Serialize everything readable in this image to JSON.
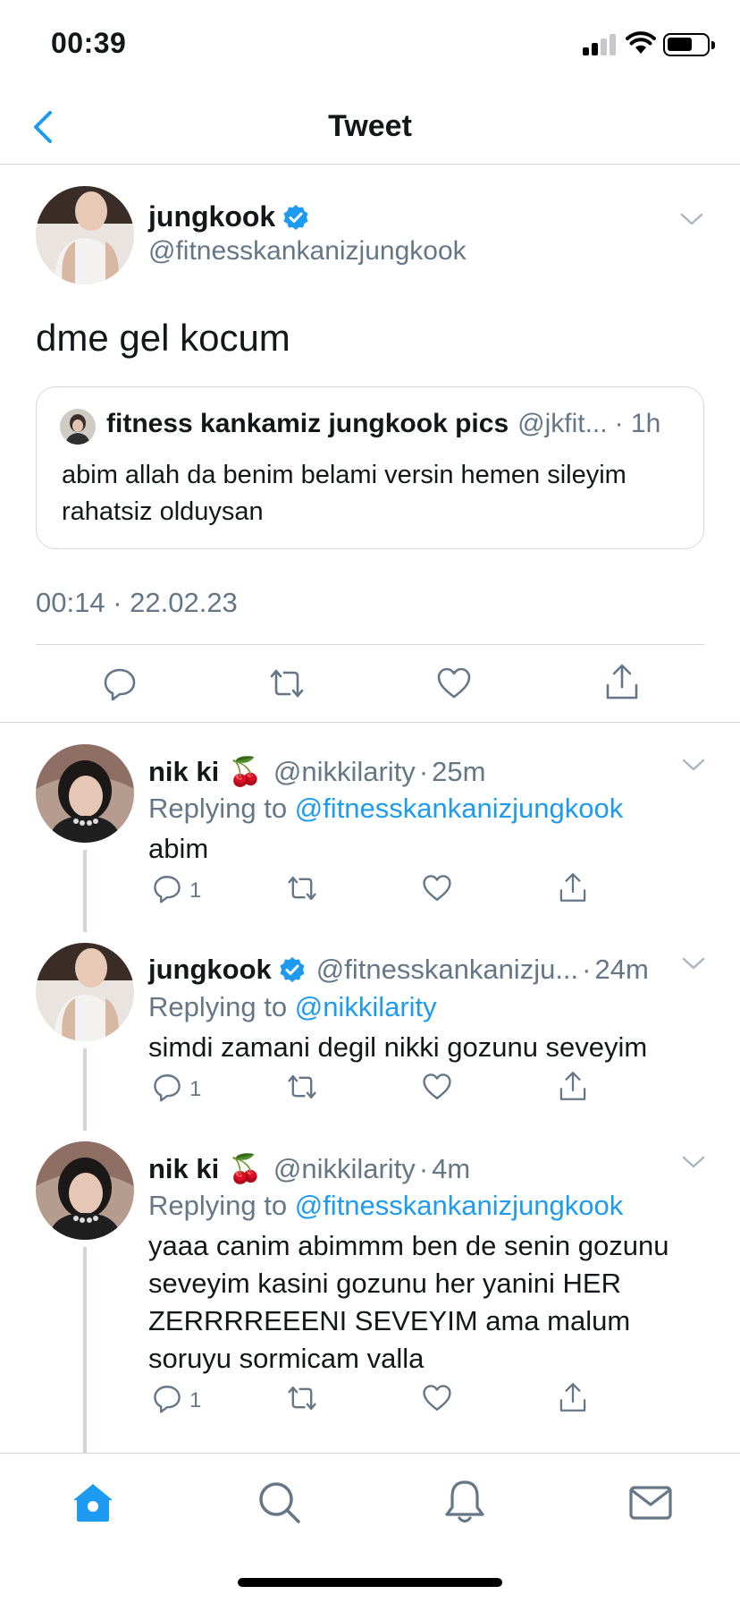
{
  "status_bar": {
    "time": "00:39"
  },
  "header": {
    "title": "Tweet"
  },
  "main_tweet": {
    "name": "jungkook",
    "handle": "@fitnesskankanizjungkook",
    "text": "dme gel kocum",
    "quote": {
      "name": "fitness kankamiz jungkook pics",
      "handle": "@jkfit...",
      "time": "· 1h",
      "text": "abim allah da benim belami versin hemen sileyim rahatsiz olduysan"
    },
    "timestamp": "00:14 · 22.02.23"
  },
  "replies": [
    {
      "name": "nik ki",
      "emoji": "🍒",
      "handle": "@nikkilarity",
      "dot": "·",
      "time": "25m",
      "replying_prefix": "Replying to",
      "replying_to": "@fitnesskankanizjungkook",
      "text": "abim",
      "reply_count": "1"
    },
    {
      "name": "jungkook",
      "handle": "@fitnesskankanizju...",
      "dot": "·",
      "time": "24m",
      "replying_prefix": "Replying to",
      "replying_to": "@nikkilarity",
      "text": "simdi zamani degil nikki gozunu seveyim",
      "reply_count": "1"
    },
    {
      "name": "nik ki",
      "emoji": "🍒",
      "handle": "@nikkilarity",
      "dot": "·",
      "time": "4m",
      "replying_prefix": "Replying to",
      "replying_to": "@fitnesskankanizjungkook",
      "text": "yaaa canim abimmm ben de senin gozunu seveyim kasini gozunu her yanini HER ZERRRREEENI SEVEYIM ama malum soruyu sormicam valla",
      "reply_count": "1"
    }
  ],
  "colors": {
    "accent": "#1d9bf0",
    "muted": "#657786",
    "border": "#d5d8dc"
  },
  "icons": {
    "back": "chevron-left-icon",
    "reply": "reply-icon",
    "retweet": "retweet-icon",
    "like": "heart-icon",
    "share": "share-icon",
    "tabs": [
      "home-icon",
      "search-icon",
      "bell-icon",
      "mail-icon"
    ]
  }
}
